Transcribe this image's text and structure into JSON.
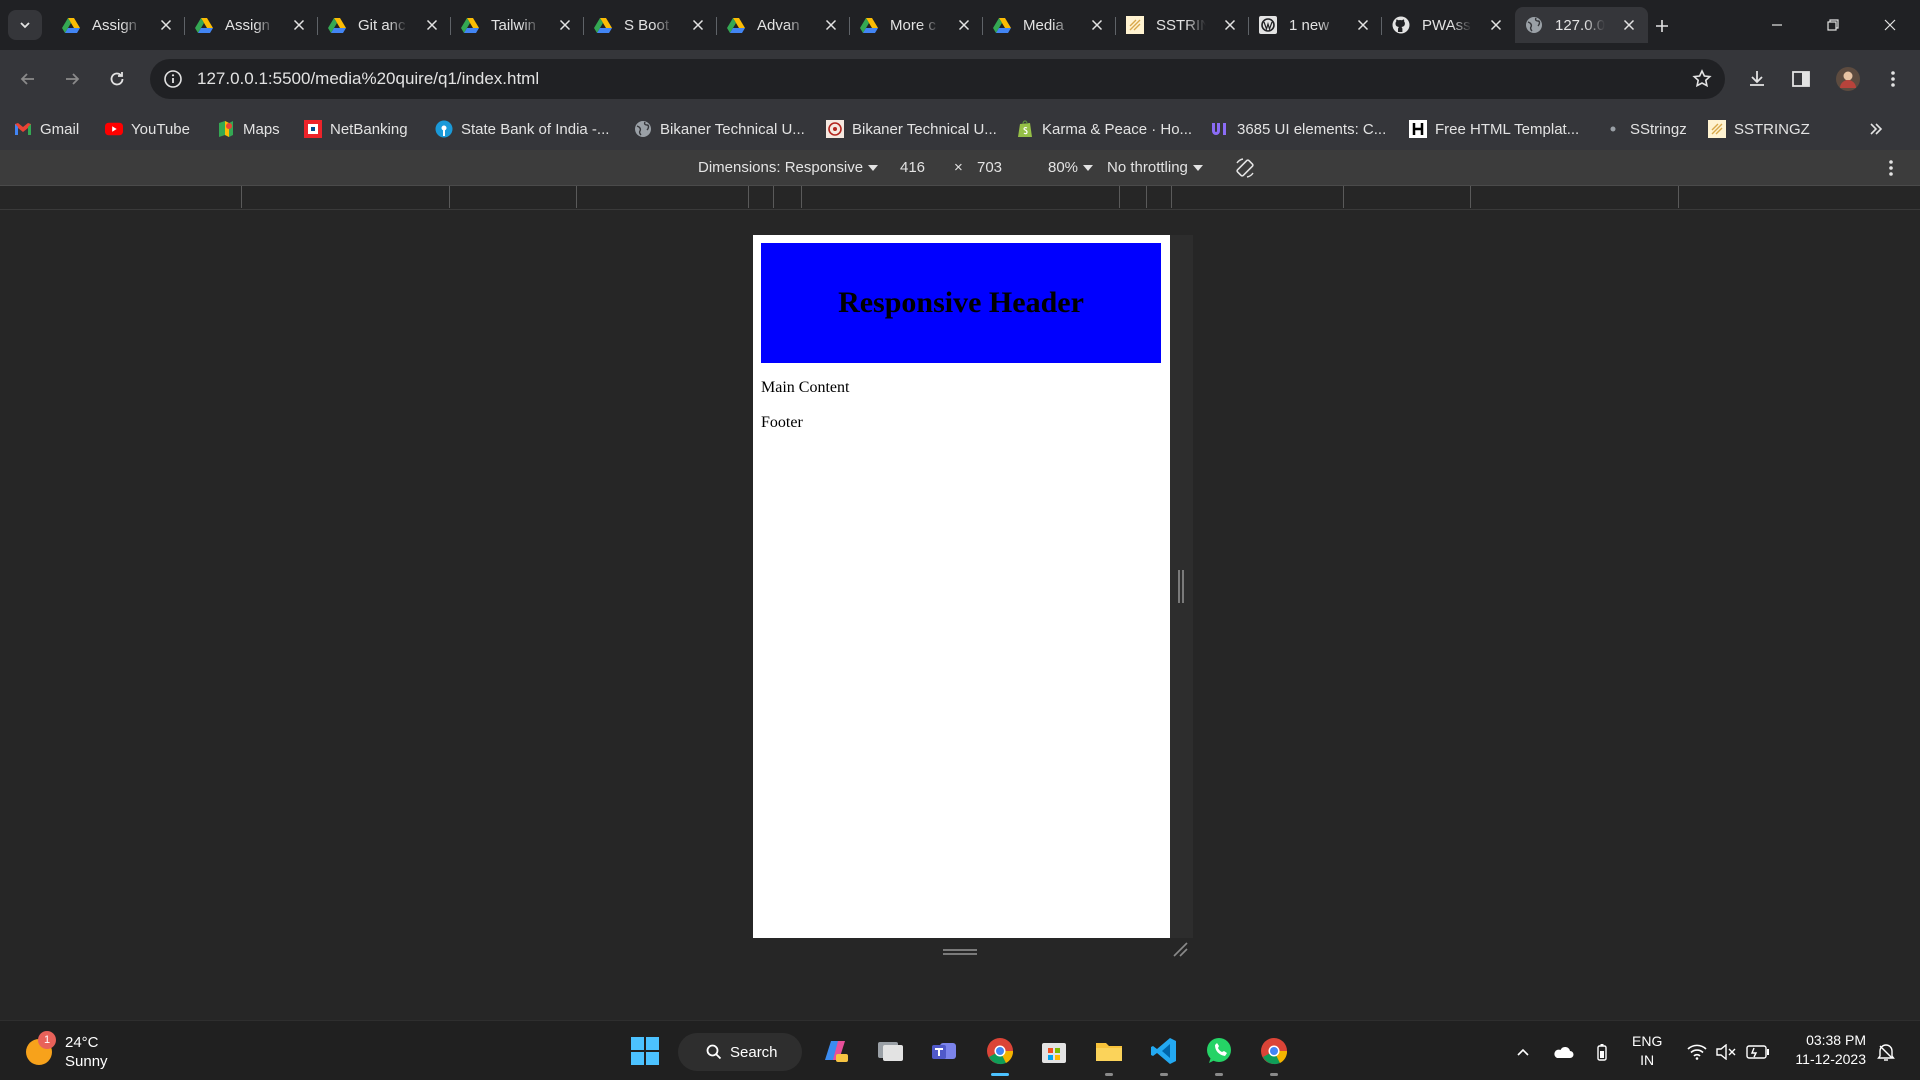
{
  "browser": {
    "tabs": [
      {
        "title": "Assign",
        "favicon": "google-drive-icon",
        "active": false
      },
      {
        "title": "Assign",
        "favicon": "google-drive-icon",
        "active": false
      },
      {
        "title": "Git anc",
        "favicon": "google-drive-icon",
        "active": false
      },
      {
        "title": "Tailwin",
        "favicon": "google-drive-icon",
        "active": false
      },
      {
        "title": "S Boot",
        "favicon": "google-drive-icon",
        "active": false
      },
      {
        "title": "Advan",
        "favicon": "google-drive-icon",
        "active": false
      },
      {
        "title": "More c",
        "favicon": "google-drive-icon",
        "active": false
      },
      {
        "title": "Media",
        "favicon": "google-drive-icon",
        "active": false
      },
      {
        "title": "SSTRIN",
        "favicon": "sstringz-icon",
        "active": false
      },
      {
        "title": "1 new",
        "favicon": "wordpress-icon",
        "active": false
      },
      {
        "title": "PWAss",
        "favicon": "github-icon",
        "active": false
      },
      {
        "title": "127.0.0",
        "favicon": "globe-icon",
        "active": true
      }
    ],
    "url": "127.0.0.1:5500/media%20quire/q1/index.html",
    "bookmarks": [
      {
        "label": "Gmail",
        "icon": "gmail-icon"
      },
      {
        "label": "YouTube",
        "icon": "youtube-icon"
      },
      {
        "label": "Maps",
        "icon": "maps-icon"
      },
      {
        "label": "NetBanking",
        "icon": "hdfc-icon"
      },
      {
        "label": "State Bank of India -...",
        "icon": "sbi-icon"
      },
      {
        "label": "Bikaner Technical U...",
        "icon": "globe-icon"
      },
      {
        "label": "Bikaner Technical U...",
        "icon": "university-icon"
      },
      {
        "label": "Karma & Peace · Ho...",
        "icon": "shopify-icon"
      },
      {
        "label": "3685 UI elements: C...",
        "icon": "uiverse-icon"
      },
      {
        "label": "Free HTML Templat...",
        "icon": "html-h-icon"
      },
      {
        "label": "SStringz",
        "icon": "dot-icon"
      },
      {
        "label": "SSTRINGZ",
        "icon": "sstringz-icon"
      }
    ]
  },
  "devtools": {
    "dimensions_label": "Dimensions: Responsive",
    "width": "416",
    "times": "×",
    "height": "703",
    "zoom": "80%",
    "throttling": "No throttling"
  },
  "page": {
    "header_title": "Responsive Header",
    "main_text": "Main Content",
    "footer_text": "Footer",
    "header_color": "#0000ff"
  },
  "taskbar": {
    "weather_temp": "24°C",
    "weather_desc": "Sunny",
    "weather_badge": "1",
    "search_label": "Search",
    "lang": "ENG",
    "region": "IN",
    "time": "03:38 PM",
    "date": "11-12-2023"
  },
  "colors": {
    "accent": "#4cc2ff",
    "chrome_dark": "#202124",
    "chrome_toolbar": "#35363a"
  }
}
